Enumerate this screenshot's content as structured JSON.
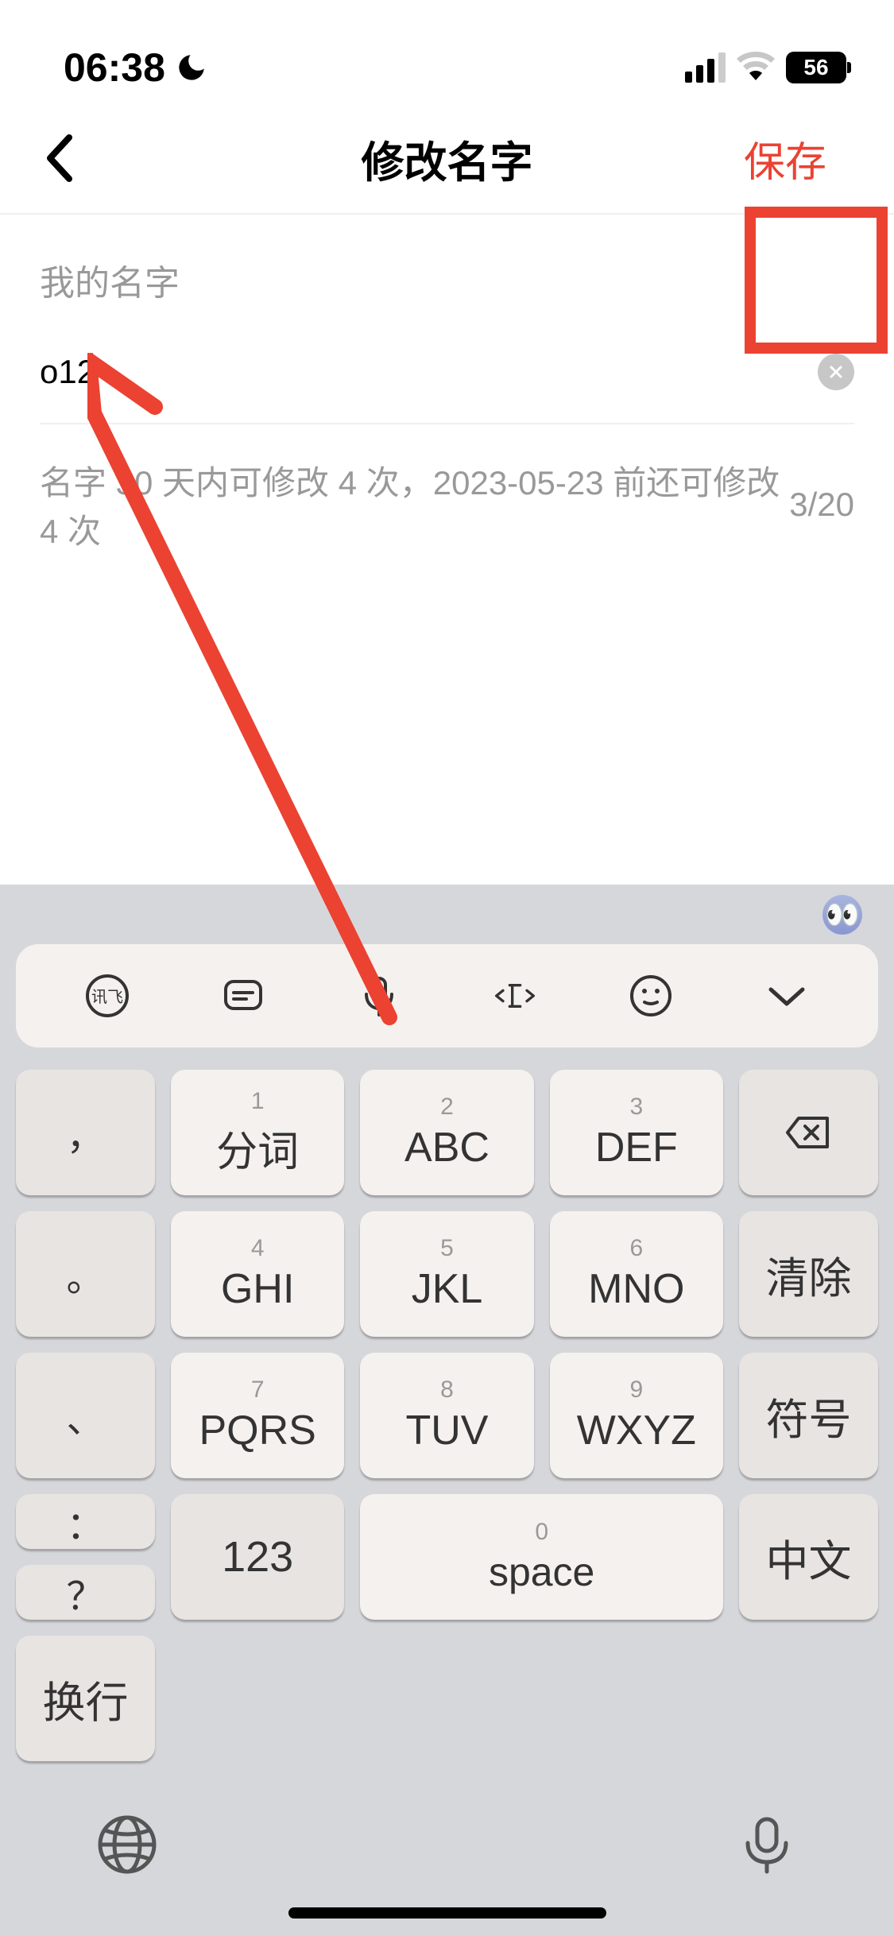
{
  "status_bar": {
    "time": "06:38",
    "battery_level": "56"
  },
  "nav": {
    "title": "修改名字",
    "save_label": "保存"
  },
  "form": {
    "field_label": "我的名字",
    "input_value": "o12",
    "info_text": "名字 30 天内可修改 4 次，2023-05-23 前还可修改 4 次",
    "char_count": "3/20"
  },
  "keyboard": {
    "keys": {
      "row1": {
        "punct": "，",
        "k1": {
          "num": "1",
          "label": "分词"
        },
        "k2": {
          "num": "2",
          "label": "ABC"
        },
        "k3": {
          "num": "3",
          "label": "DEF"
        }
      },
      "row2": {
        "punct": "。",
        "k1": {
          "num": "4",
          "label": "GHI"
        },
        "k2": {
          "num": "5",
          "label": "JKL"
        },
        "k3": {
          "num": "6",
          "label": "MNO"
        },
        "func": "清除"
      },
      "row3": {
        "punct": "、",
        "k1": {
          "num": "7",
          "label": "PQRS"
        },
        "k2": {
          "num": "8",
          "label": "TUV"
        },
        "k3": {
          "num": "9",
          "label": "WXYZ"
        },
        "func": "符号"
      },
      "row4": {
        "punct1": "：",
        "punct2": "？",
        "k1": "123",
        "space": {
          "num": "0",
          "label": "space"
        },
        "k3": "中文",
        "func": "换行"
      }
    }
  }
}
